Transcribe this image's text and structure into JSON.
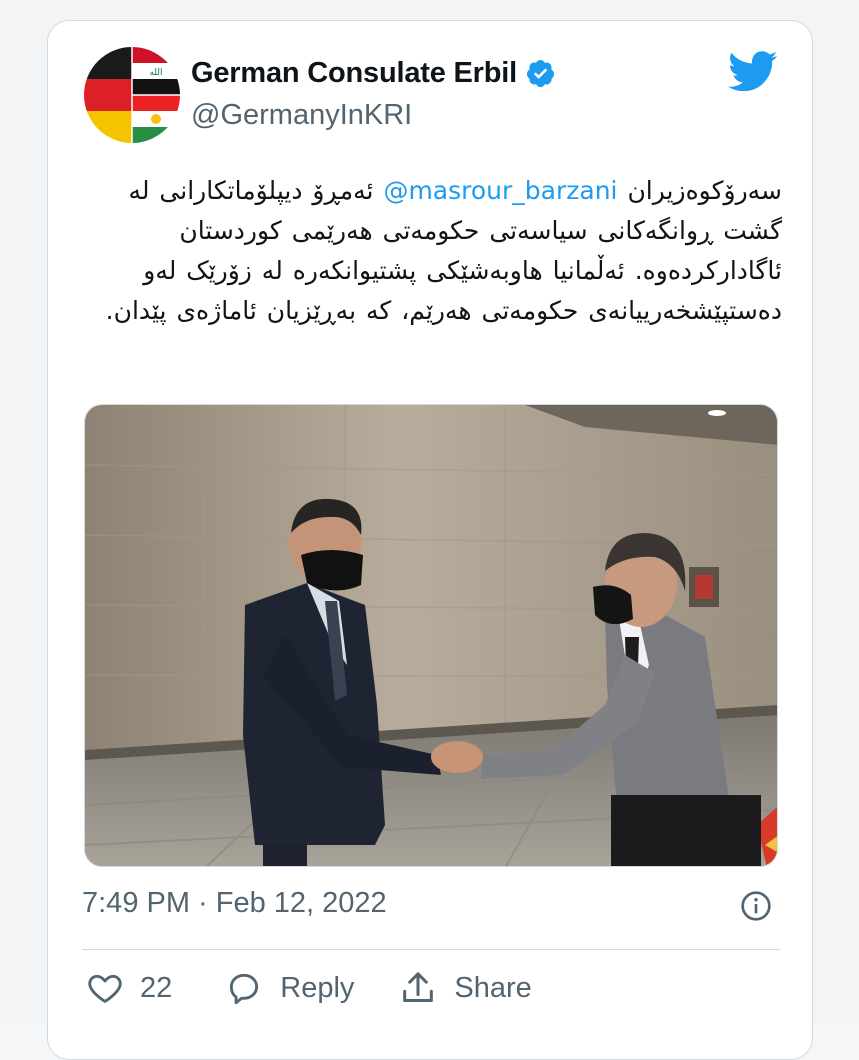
{
  "account": {
    "display_name": "German Consulate Erbil",
    "handle": "@GermanyInKRI",
    "verified_icon": "verified-badge-icon",
    "avatar_icon": "germany-iraq-kurdistan-flags-avatar"
  },
  "tweet": {
    "text_prefix": "سەرۆکوەزیران ",
    "mention": "@masrour_barzani",
    "text_suffix": " ئەمڕۆ دیپلۆماتکارانی لە گشت ڕوانگەکانی سیاسەتی حکومەتی هەرێمی کوردستان ئاگادارکردەوە. ئەڵمانیا هاوبەشێکی پشتیوانکەرە لە زۆرێک لەو دەستپێشخەرییانەی حکومەتی هەرێم، کە بەڕێزیان ئاماژەی پێدان.",
    "timestamp": "7:49 PM · Feb 12, 2022"
  },
  "actions": {
    "like_count": "22",
    "reply_label": "Reply",
    "share_label": "Share"
  },
  "colors": {
    "accent": "#1d9bf0",
    "text": "#0f1419",
    "secondary": "#536471",
    "border": "#cfd9de"
  }
}
